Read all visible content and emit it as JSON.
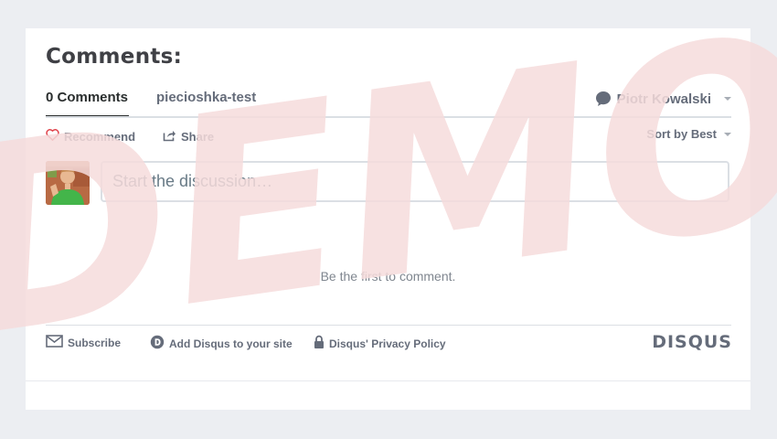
{
  "page_title": "Comments:",
  "tabs": {
    "comment_count": "0 Comments",
    "forum_name": "piecioshka-test"
  },
  "user": {
    "name": "Piotr Kowalski"
  },
  "actions": {
    "recommend": "Recommend",
    "share": "Share",
    "sort": "Sort by Best"
  },
  "composer": {
    "placeholder": "Start the discussion…",
    "value": ""
  },
  "empty_state": "Be the first to comment.",
  "footer": {
    "subscribe": "Subscribe",
    "add_disqus": "Add Disqus to your site",
    "privacy": "Disqus' Privacy Policy",
    "brand": "DISQUS"
  },
  "watermark": {
    "text": "DEMO",
    "color": "#f6dcdc"
  },
  "colors": {
    "background": "#eceef2",
    "text_dark": "#2a2e2e",
    "text_muted": "#656c7a",
    "heart": "#e0444c"
  },
  "icons": [
    "chat-bubble-icon",
    "chevron-down-icon",
    "heart-icon",
    "share-icon",
    "mail-icon",
    "disqus-d-icon",
    "lock-icon"
  ]
}
